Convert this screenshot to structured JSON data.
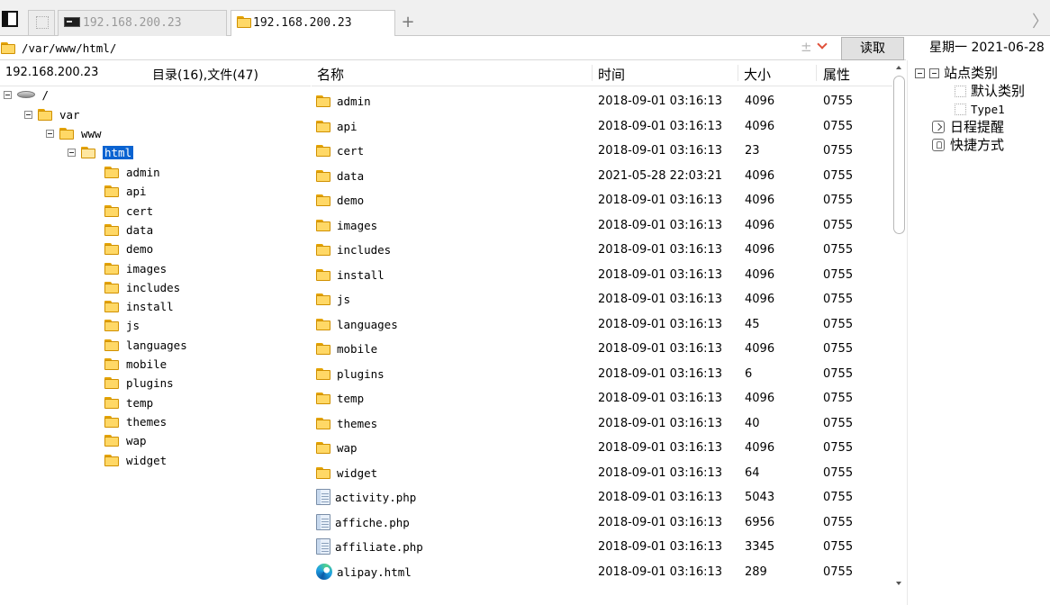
{
  "tabs": [
    {
      "label": "192.168.200.23",
      "active": false,
      "icon": "terminal-icon"
    },
    {
      "label": "192.168.200.23",
      "active": true,
      "icon": "folder-icon"
    }
  ],
  "address": {
    "path": "/var/www/html/",
    "controls": {
      "plus_minus": "±"
    }
  },
  "read_button": "读取",
  "date_label": "星期一  2021-06-28",
  "left_panel": {
    "host": "192.168.200.23",
    "counts": "目录(16),文件(47)",
    "tree": {
      "root": "/",
      "var": "var",
      "www": "www",
      "html": "html",
      "children": [
        "admin",
        "api",
        "cert",
        "data",
        "demo",
        "images",
        "includes",
        "install",
        "js",
        "languages",
        "mobile",
        "plugins",
        "temp",
        "themes",
        "wap",
        "widget"
      ]
    }
  },
  "columns": {
    "name": "名称",
    "time": "时间",
    "size": "大小",
    "attr": "属性"
  },
  "files": [
    {
      "name": "admin",
      "time": "2018-09-01 03:16:13",
      "size": "4096",
      "attr": "0755",
      "type": "folder"
    },
    {
      "name": "api",
      "time": "2018-09-01 03:16:13",
      "size": "4096",
      "attr": "0755",
      "type": "folder"
    },
    {
      "name": "cert",
      "time": "2018-09-01 03:16:13",
      "size": "23",
      "attr": "0755",
      "type": "folder"
    },
    {
      "name": "data",
      "time": "2021-05-28 22:03:21",
      "size": "4096",
      "attr": "0755",
      "type": "folder"
    },
    {
      "name": "demo",
      "time": "2018-09-01 03:16:13",
      "size": "4096",
      "attr": "0755",
      "type": "folder"
    },
    {
      "name": "images",
      "time": "2018-09-01 03:16:13",
      "size": "4096",
      "attr": "0755",
      "type": "folder"
    },
    {
      "name": "includes",
      "time": "2018-09-01 03:16:13",
      "size": "4096",
      "attr": "0755",
      "type": "folder"
    },
    {
      "name": "install",
      "time": "2018-09-01 03:16:13",
      "size": "4096",
      "attr": "0755",
      "type": "folder"
    },
    {
      "name": "js",
      "time": "2018-09-01 03:16:13",
      "size": "4096",
      "attr": "0755",
      "type": "folder"
    },
    {
      "name": "languages",
      "time": "2018-09-01 03:16:13",
      "size": "45",
      "attr": "0755",
      "type": "folder"
    },
    {
      "name": "mobile",
      "time": "2018-09-01 03:16:13",
      "size": "4096",
      "attr": "0755",
      "type": "folder"
    },
    {
      "name": "plugins",
      "time": "2018-09-01 03:16:13",
      "size": "6",
      "attr": "0755",
      "type": "folder"
    },
    {
      "name": "temp",
      "time": "2018-09-01 03:16:13",
      "size": "4096",
      "attr": "0755",
      "type": "folder"
    },
    {
      "name": "themes",
      "time": "2018-09-01 03:16:13",
      "size": "40",
      "attr": "0755",
      "type": "folder"
    },
    {
      "name": "wap",
      "time": "2018-09-01 03:16:13",
      "size": "4096",
      "attr": "0755",
      "type": "folder"
    },
    {
      "name": "widget",
      "time": "2018-09-01 03:16:13",
      "size": "64",
      "attr": "0755",
      "type": "folder"
    },
    {
      "name": "activity.php",
      "time": "2018-09-01 03:16:13",
      "size": "5043",
      "attr": "0755",
      "type": "file"
    },
    {
      "name": "affiche.php",
      "time": "2018-09-01 03:16:13",
      "size": "6956",
      "attr": "0755",
      "type": "file"
    },
    {
      "name": "affiliate.php",
      "time": "2018-09-01 03:16:13",
      "size": "3345",
      "attr": "0755",
      "type": "file"
    },
    {
      "name": "alipay.html",
      "time": "2018-09-01 03:16:13",
      "size": "289",
      "attr": "0755",
      "type": "html"
    }
  ],
  "right_panel": {
    "site_category": "站点类别",
    "default_category": "默认类别",
    "type1": "Type1",
    "schedule": "日程提醒",
    "shortcuts": "快捷方式"
  },
  "colors": {
    "selection": "#0a63d1",
    "folder": "#ffd866",
    "accent_arrow": "#e0503a"
  }
}
